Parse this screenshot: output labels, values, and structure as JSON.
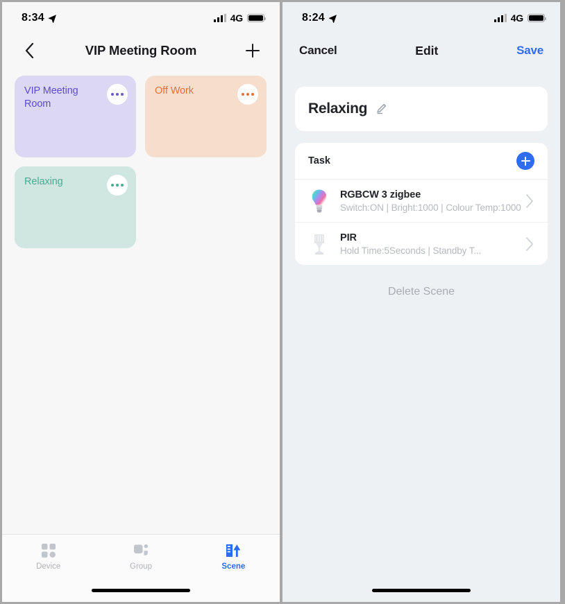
{
  "left": {
    "status": {
      "time": "8:34",
      "network": "4G"
    },
    "nav": {
      "back_icon": "chevron-left-icon",
      "title": "VIP Meeting Room",
      "add_icon": "plus-icon"
    },
    "scenes": [
      {
        "name": "VIP Meeting Room",
        "bg": "#dcd7f2",
        "fg": "#5b4dc8",
        "dots": "#6a5ad0"
      },
      {
        "name": "Off Work",
        "bg": "#f7ddcc",
        "fg": "#e2713a",
        "dots": "#e2713a"
      },
      {
        "name": "Relaxing",
        "bg": "#cfe7e0",
        "fg": "#4aab92",
        "dots": "#4aab92"
      }
    ],
    "tabs": [
      {
        "label": "Device",
        "icon": "grid-squares-icon",
        "active": false
      },
      {
        "label": "Group",
        "icon": "group-shapes-icon",
        "active": false
      },
      {
        "label": "Scene",
        "icon": "scene-building-tree-icon",
        "active": true
      }
    ]
  },
  "right": {
    "status": {
      "time": "8:24",
      "network": "4G"
    },
    "nav": {
      "cancel": "Cancel",
      "title": "Edit",
      "save": "Save"
    },
    "scene_name": {
      "value": "Relaxing",
      "edit_icon": "pencil-icon"
    },
    "task_section": {
      "label": "Task",
      "add_icon": "plus-circle-icon"
    },
    "tasks": [
      {
        "icon": "rgb-bulb-icon",
        "name": "RGBCW 3 zigbee",
        "desc": "Switch:ON | Bright:1000 | Colour Temp:1000"
      },
      {
        "icon": "pir-sensor-icon",
        "name": "PIR",
        "desc": "Hold Time:5Seconds | Standby T..."
      }
    ],
    "delete_label": "Delete Scene"
  },
  "colors": {
    "accent": "#2f6cf0",
    "muted": "#b6b9bf"
  }
}
